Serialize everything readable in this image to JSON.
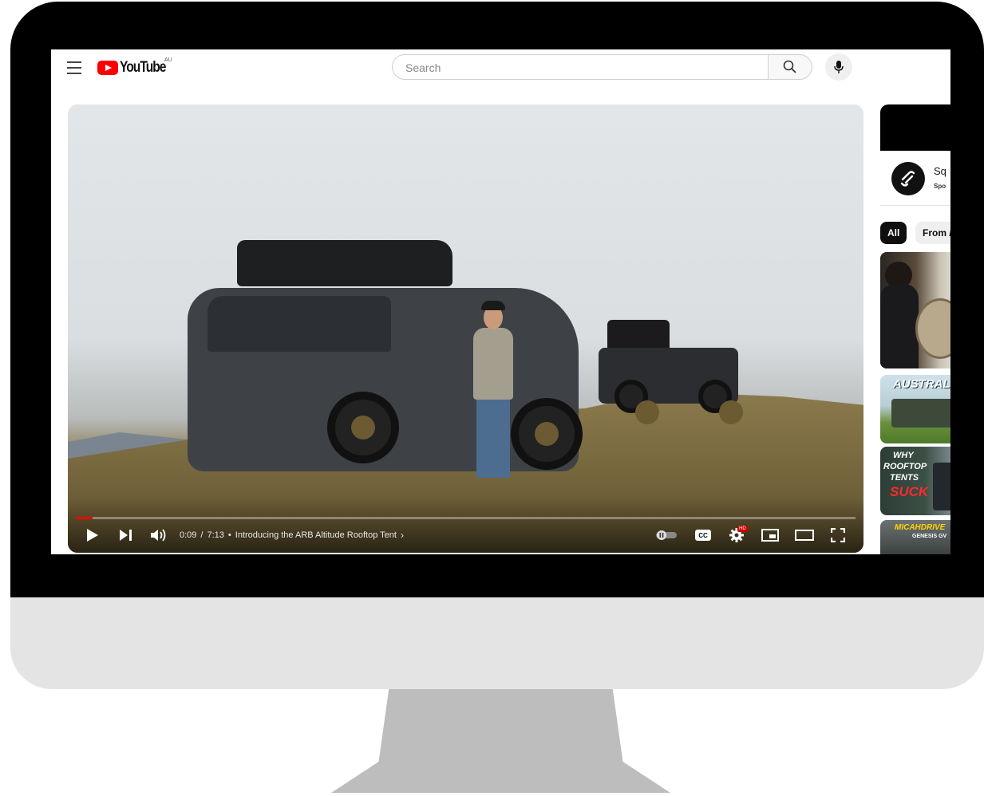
{
  "masthead": {
    "logo_text": "YouTube",
    "region_code": "AU",
    "search_placeholder": "Search",
    "icons": [
      "menu-icon",
      "search-icon",
      "mic-icon"
    ]
  },
  "player": {
    "progress": 0.021,
    "current_time": "0:09",
    "separator": "/",
    "duration": "7:13",
    "bullet": "•",
    "chapter_title": "Introducing the ARB Altitude Rooftop Tent",
    "chapter_chevron": "›",
    "cc_label": "CC",
    "quality_badge": "HD",
    "colors": {
      "progress": "#ff0000"
    },
    "icons": [
      "play-icon",
      "next-icon",
      "volume-icon",
      "autoplay-toggle-icon",
      "subtitles-icon",
      "settings-icon",
      "miniplayer-icon",
      "theater-icon",
      "fullscreen-icon"
    ]
  },
  "sidebar": {
    "sponsor_name": "Sq",
    "sponsor_tag": "Spo",
    "chips": [
      "All",
      "From /"
    ],
    "thumbnails": [
      {
        "text": ""
      },
      {
        "text": "AUSTRALIAS"
      },
      {
        "line1": "WHY",
        "line2": "ROOFTOP",
        "line3": "TENTS",
        "line4": "SUCK"
      },
      {
        "line1": "MICAHDRIVE",
        "line2": "GENESIS GV"
      }
    ]
  }
}
